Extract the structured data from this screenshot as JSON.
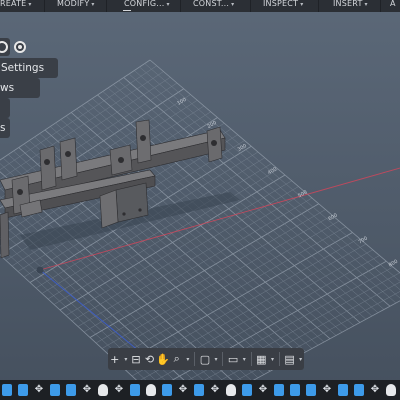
{
  "toolbar": {
    "menus": [
      {
        "label": "REATE",
        "caret": "▾"
      },
      {
        "label": "MODIFY",
        "caret": "▾"
      },
      {
        "label": "CONFIG...",
        "caret": "▾"
      },
      {
        "label": "CONST...",
        "caret": "▾"
      },
      {
        "label": "INSPECT",
        "caret": "▾"
      },
      {
        "label": "INSERT",
        "caret": "▾"
      },
      {
        "label": "A",
        "caret": ""
      }
    ]
  },
  "browser": {
    "settings_label": "Settings",
    "views_label": "ws",
    "item3_label": "",
    "item4_label": "s"
  },
  "navbar": {
    "items": [
      {
        "icon": "+",
        "name": "plus-icon"
      },
      {
        "icon": "⊟",
        "name": "capture-icon"
      },
      {
        "icon": "✋",
        "name": "pan-icon"
      },
      {
        "icon": "⌕",
        "name": "zoom-icon"
      },
      {
        "icon": "▢",
        "name": "fit-icon"
      },
      {
        "icon": "▭",
        "name": "display-settings-icon"
      },
      {
        "icon": "▦",
        "name": "grid-icon"
      },
      {
        "icon": "▤",
        "name": "viewports-icon"
      }
    ]
  },
  "timeline": {
    "items": [
      "body",
      "body",
      "move",
      "body",
      "body",
      "move",
      "cyl",
      "move",
      "body",
      "cyl",
      "body",
      "move",
      "body",
      "move",
      "cyl",
      "body",
      "move",
      "body",
      "body",
      "body",
      "move",
      "body",
      "body",
      "move",
      "cyl",
      "body",
      "move",
      "body",
      "body",
      "body"
    ]
  },
  "grid_labels": [
    "100",
    "200",
    "300",
    "400",
    "500",
    "600",
    "700",
    "800"
  ],
  "colors": {
    "accent": "#2a8ef0",
    "background": "#4f5d70",
    "x_axis": "#d9455a",
    "y_axis": "#3c5ecf"
  }
}
